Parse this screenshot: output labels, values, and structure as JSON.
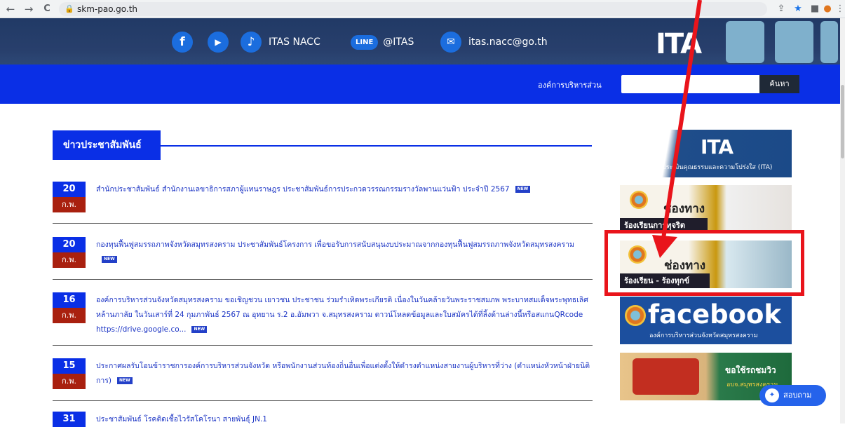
{
  "browser": {
    "url": "skm-pao.go.th",
    "back": "←",
    "forward": "→",
    "reload": "C"
  },
  "top_strip": {
    "facebook_glyph": "f",
    "youtube_glyph": "▶",
    "tiktok_glyph": "♪",
    "itas_label": "ITAS NACC",
    "line_badge": "LINE",
    "line_label": "@ITAS",
    "mail_glyph": "✉",
    "email_label": "itas.nacc@go.th",
    "logo_text": "ITA"
  },
  "header": {
    "org_label": "องค์การบริหารส่วน",
    "search_button": "ค้นหา"
  },
  "section": {
    "title": "ข่าวประชาสัมพันธ์"
  },
  "news": [
    {
      "day": "20",
      "month": "ก.พ.",
      "text": "สำนักประชาสัมพันธ์ สำนักงานเลขาธิการสภาผู้แทนราษฎร ประชาสัมพันธ์การประกวดวรรณกรรมรางวัลพานแว่นฟ้า ประจำปี 2567",
      "badge": "NEW"
    },
    {
      "day": "20",
      "month": "ก.พ.",
      "text": "กองทุนฟื้นฟูสมรรถภาพจังหวัดสมุทรสงคราม ประชาสัมพันธ์โครงการ เพื่อขอรับการสนับสนุนงบประมาณจากกองทุนฟื้นฟูสมรรถภาพจังหวัดสมุทรสงคราม",
      "badge": "NEW"
    },
    {
      "day": "16",
      "month": "ก.พ.",
      "text": "องค์การบริหารส่วนจังหวัดสมุทรสงคราม ขอเชิญชวน เยาวชน ประชาชน ร่วมรำเทิดพระเกียรติ เนื่องในวันคล้ายวันพระราชสมภพ พระบาทสมเด็จพระพุทธเลิศหล้านภาลัย ในวันเสาร์ที่ 24 กุมภาพันธ์ 2567 ณ อุทยาน ร.2 อ.อัมพวา จ.สมุทรสงคราม ดาวน์โหลดข้อมูลและใบสมัครได้ที่ลิ้งด้านล่างนี้หรือสแกนQRcode https://drive.google.co...",
      "badge": "NEW"
    },
    {
      "day": "15",
      "month": "ก.พ.",
      "text": "ประกาศผลรับโอนข้าราชการองค์การบริหารส่วนจังหวัด หรือพนักงานส่วนท้องถิ่นอื่นเพื่อแต่งตั้งให้ดำรงตำแหน่งสายงานผู้บริหารที่ว่าง (ตำแหน่งหัวหน้าฝ่ายนิติการ)",
      "badge": "NEW"
    },
    {
      "day": "31",
      "month": "",
      "text": "ประชาสัมพันธ์ โรคติดเชื้อไวรัสโคโรนา สายพันธุ์ JN.1",
      "badge": ""
    }
  ],
  "banners": {
    "ita_logo": "ITA",
    "ita_caption": "ประเมินคุณธรรมและความโปร่งใส (ITA)",
    "corruption_title": "ช่องทาง",
    "corruption_sub": "ร้องเรียนการทุจริต",
    "complaint_title": "ช่องทาง",
    "complaint_sub": "ร้องเรียน - ร้องทุกข์",
    "facebook_word": "facebook",
    "facebook_caption": "องค์การบริหารส่วนจังหวัดสมุทรสงคราม",
    "bus_title": "ขอใช้รถชมวิว",
    "bus_sub": "อบจ.สมุทรสงคราม"
  },
  "chat": {
    "label": "สอบถาม"
  },
  "colors": {
    "primary_blue": "#0a2fe6",
    "date_red": "#a9200f",
    "highlight_red": "#e9141b",
    "link_blue": "#1a33c4"
  }
}
